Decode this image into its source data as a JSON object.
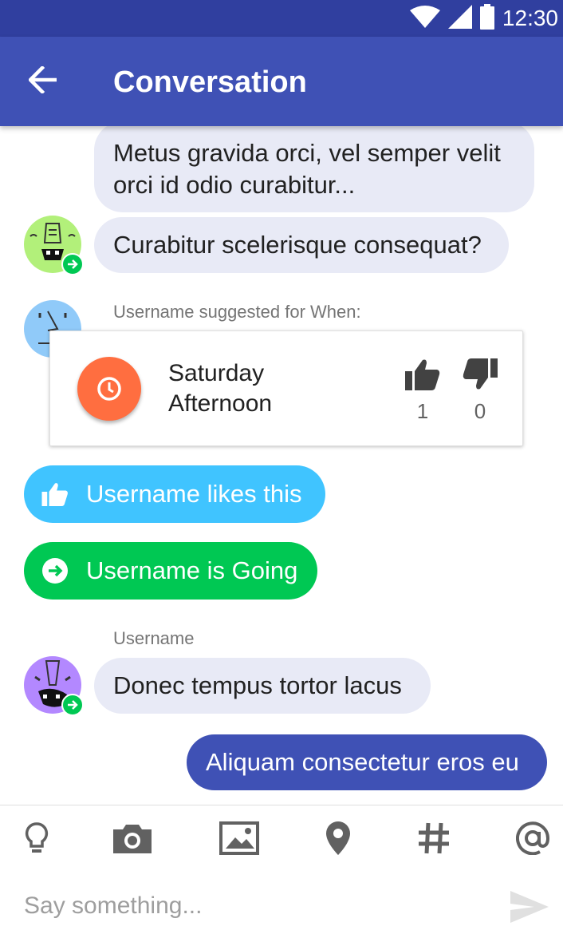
{
  "status_bar": {
    "time": "12:30",
    "icons": [
      "wifi-icon",
      "signal-icon",
      "battery-icon"
    ]
  },
  "app_bar": {
    "title": "Conversation",
    "back_icon": "arrow-back-icon"
  },
  "messages": [
    {
      "text": "Metus gravida orci, vel semper velit orci id odio curabitur..."
    },
    {
      "text": "Curabitur scelerisque consequat?"
    }
  ],
  "suggestion": {
    "label": "Username suggested for When:",
    "title": "Saturday Afternoon",
    "likes": "1",
    "dislikes": "0"
  },
  "activity": {
    "likes_text": "Username likes this",
    "going_text": "Username is Going"
  },
  "message_group": {
    "sender": "Username",
    "text": "Donec tempus tortor lacus"
  },
  "outgoing": {
    "text": "Aliquam consectetur eros eu"
  },
  "toolbar": [
    "lightbulb-icon",
    "camera-icon",
    "image-icon",
    "location-icon",
    "hashtag-icon",
    "at-icon"
  ],
  "composer": {
    "placeholder": "Say something..."
  },
  "colors": {
    "primary": "#3F51B5",
    "primary_dark": "#303F9F",
    "bubble": "#E8EAF6",
    "like": "#40C4FF",
    "going": "#00C853",
    "clock": "#FF6E40"
  }
}
